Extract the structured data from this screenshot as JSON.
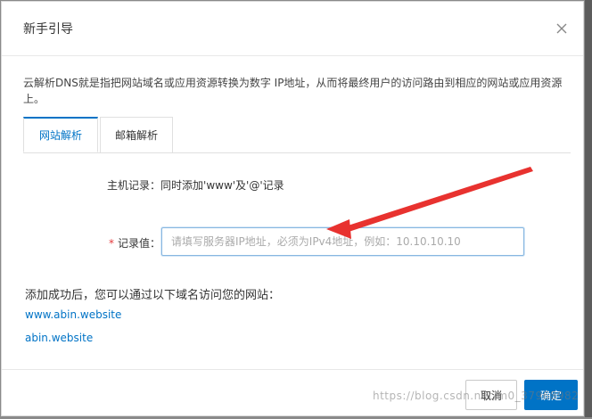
{
  "dialog": {
    "title": "新手引导",
    "intro": "云解析DNS就是指把网站域名或应用资源转换为数字 IP地址，从而将最终用户的访问路由到相应的网站或应用资源上。"
  },
  "tabs": [
    {
      "label": "网站解析",
      "active": true
    },
    {
      "label": "邮箱解析",
      "active": false
    }
  ],
  "form": {
    "host_label": "主机记录：",
    "host_value": "同时添加'www'及'@'记录",
    "required_mark": "*",
    "value_label": "记录值：",
    "value_input": "",
    "value_placeholder": "请填写服务器IP地址，必须为IPv4地址，例如：10.10.10.10"
  },
  "result": {
    "note": "添加成功后，您可以通过以下域名访问您的网站：",
    "domains": [
      "www.abin.website",
      "abin.website"
    ]
  },
  "footer": {
    "cancel_label": "取消",
    "ok_label": "确定"
  },
  "watermark": "https://blog.csdn.net/m0_37968982",
  "colors": {
    "accent": "#0073c6",
    "required": "#e4393c",
    "annotation_arrow": "#e8322f"
  }
}
